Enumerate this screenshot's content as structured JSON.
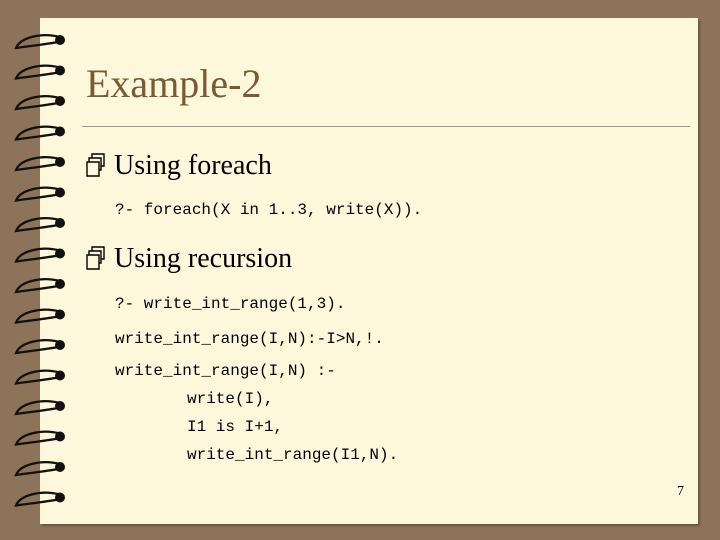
{
  "slide": {
    "title": "Example-2",
    "bullets": [
      {
        "icon": "4-bullet-icon",
        "label": "Using foreach"
      },
      {
        "icon": "4-bullet-icon",
        "label": "Using recursion"
      }
    ],
    "code": {
      "foreach_query": "?- foreach(X in 1..3, write(X)).",
      "recursion_query": "?- write_int_range(1,3).",
      "base_case": "write_int_range(I,N):-I>N,!.",
      "rule_head": "write_int_range(I,N) :-",
      "body_1": "write(I),",
      "body_2": "I1 is I+1,",
      "body_3": "write_int_range(I1,N)."
    },
    "page_number": "7"
  },
  "colors": {
    "background": "#8c735a",
    "paper": "#fdf7dc",
    "title": "#7a5a34"
  }
}
